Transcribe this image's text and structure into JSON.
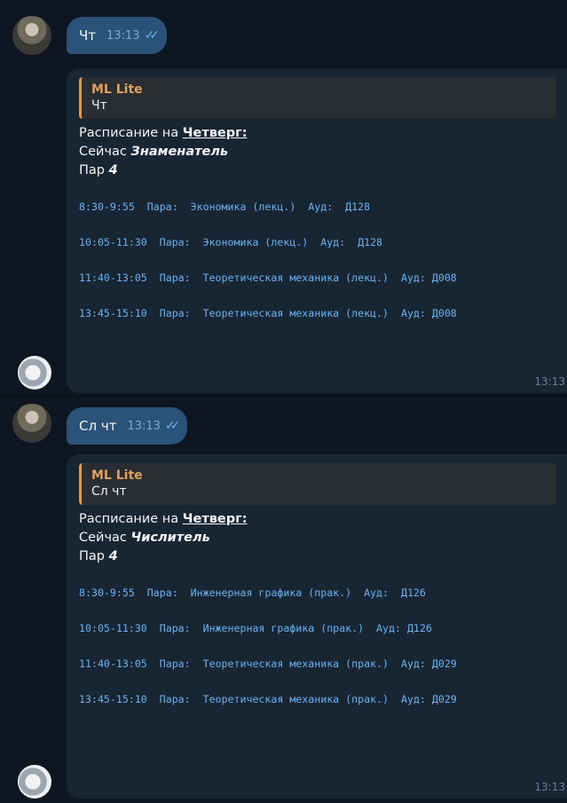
{
  "messages": [
    {
      "out_text": "Чт",
      "out_time": "13:13",
      "ticks": "✓✓",
      "reply_name": "ML Lite",
      "reply_text": "Чт",
      "schedule_prefix": "Расписание на ",
      "day": "Четверг:",
      "now_prefix": "Сейчас ",
      "week": "Знаменатель",
      "pairs_prefix": "Пар ",
      "pairs_count": "4",
      "lessons": [
        "8:30-9:55  Пара:  Экономика (лекц.)  Ауд:  Д128",
        "10:05-11:30  Пара:  Экономика (лекц.)  Ауд:  Д128",
        "11:40-13:05  Пара:  Теоретическая механика (лекц.)  Ауд: Д008",
        "13:45-15:10  Пара:  Теоретическая механика (лекц.)  Ауд: Д008"
      ],
      "in_time": "13:13"
    },
    {
      "out_text": "Сл чт",
      "out_time": "13:13",
      "ticks": "✓✓",
      "reply_name": "ML Lite",
      "reply_text": "Сл чт",
      "schedule_prefix": "Расписание на ",
      "day": "Четверг:",
      "now_prefix": "Сейчас ",
      "week": "Числитель",
      "pairs_prefix": "Пар ",
      "pairs_count": "4",
      "lessons": [
        "8:30-9:55  Пара:  Инженерная графика (прак.)  Ауд:  Д126",
        "10:05-11:30  Пара:  Инженерная графика (прак.)  Ауд: Д126",
        "11:40-13:05  Пара:  Теоретическая механика (прак.)  Ауд: Д029",
        "13:45-15:10  Пара:  Теоретическая механика (прак.)  Ауд: Д029"
      ],
      "in_time": "13:13"
    }
  ],
  "colors": {
    "background": "#0e1621",
    "outgoing_bubble": "#2b5278",
    "incoming_bubble": "#182533",
    "reply_accent": "#e2a05f",
    "mono_link": "#6ab3f3"
  },
  "icons": {
    "user_avatar": "user-avatar-icon",
    "bot_avatar": "bot-avatar-icon",
    "read_ticks": "double-check-icon"
  }
}
